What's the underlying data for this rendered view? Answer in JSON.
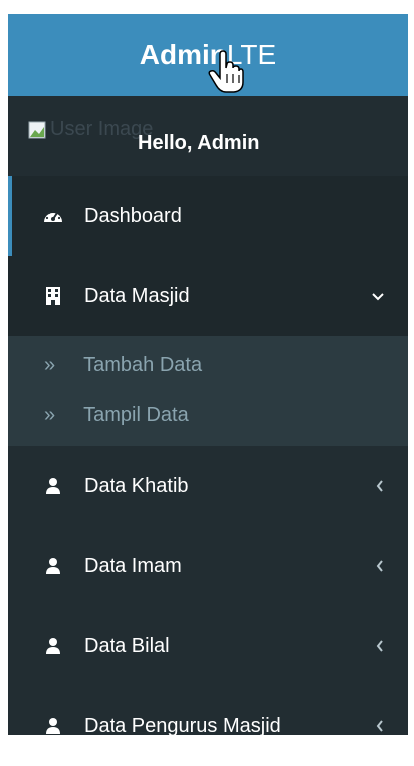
{
  "brand": {
    "logo_bold": "Admin",
    "logo_regular": "LTE"
  },
  "user": {
    "image_alt": "User Image",
    "greeting": "Hello, Admin"
  },
  "menu": {
    "dashboard": {
      "label": "Dashboard",
      "icon": "dashboard-icon"
    },
    "data_masjid": {
      "label": "Data Masjid",
      "icon": "building-icon",
      "expanded": true,
      "children": [
        {
          "label": "Tambah Data"
        },
        {
          "label": "Tampil Data"
        }
      ]
    },
    "data_khatib": {
      "label": "Data Khatib",
      "icon": "user-icon"
    },
    "data_imam": {
      "label": "Data Imam",
      "icon": "user-icon"
    },
    "data_bilal": {
      "label": "Data Bilal",
      "icon": "user-icon"
    },
    "data_pengurus": {
      "label": "Data Pengurus Masjid",
      "icon": "user-icon"
    }
  },
  "colors": {
    "header": "#3c8dbc",
    "sidebar": "#222d32",
    "active_border": "#3c8dbc",
    "submenu": "#2c3b41"
  }
}
